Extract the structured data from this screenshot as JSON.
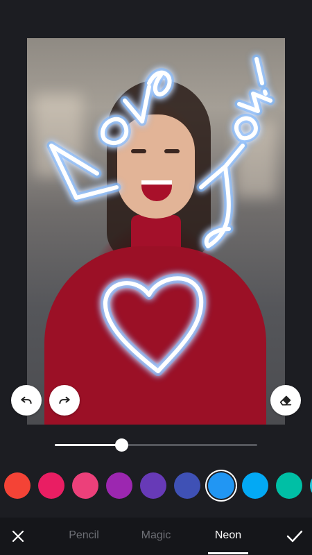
{
  "canvas": {
    "photo_alt": "Smiling woman in red top",
    "drawing_text": [
      "Love",
      "You!"
    ],
    "drawing_shape": "heart-shape"
  },
  "controls": {
    "undo_icon": "undo-icon",
    "redo_icon": "redo-icon",
    "eraser_icon": "eraser-icon"
  },
  "brush_size": {
    "value_fraction": 0.33
  },
  "palette": {
    "colors": [
      "#f44336",
      "#e91e63",
      "#ec407a",
      "#9c27b0",
      "#673ab7",
      "#3f51b5",
      "#2196f3",
      "#03a9f4",
      "#00bfa5",
      "#26c6da"
    ],
    "selected_index": 6
  },
  "bottom_bar": {
    "close_icon": "close-icon",
    "confirm_icon": "check-icon",
    "tabs": [
      {
        "label": "Pencil",
        "active": false
      },
      {
        "label": "Magic",
        "active": false
      },
      {
        "label": "Neon",
        "active": true
      }
    ]
  }
}
